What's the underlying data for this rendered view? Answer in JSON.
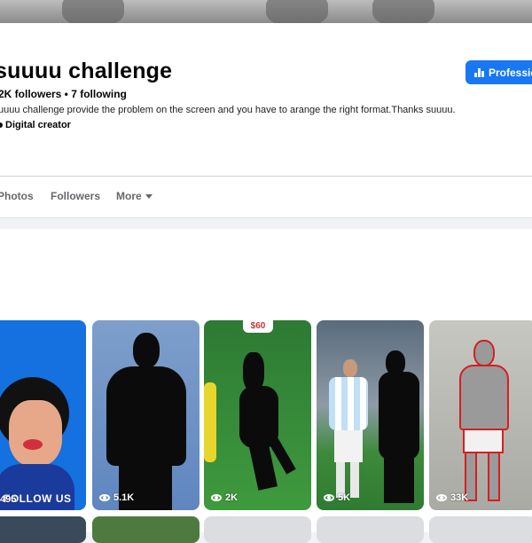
{
  "profile": {
    "name": "suuuu challenge",
    "stats": "2K followers • 7 following",
    "bio": "uuuu challenge provide the problem on the screen and you have to arange the right format.Thanks suuuu.",
    "category": "Digital creator",
    "pro_button": "Professio"
  },
  "tabs": {
    "photos": "Photos",
    "followers": "Followers",
    "more": "More"
  },
  "reels": [
    {
      "views": "495",
      "overlay": "FOLLOW US"
    },
    {
      "views": "5.1K"
    },
    {
      "views": "2K",
      "badge": "$60"
    },
    {
      "views": "5K"
    },
    {
      "views": "33K"
    }
  ],
  "colors": {
    "accent": "#1877f2",
    "background": "#f0f2f5",
    "card": "#ffffff"
  }
}
